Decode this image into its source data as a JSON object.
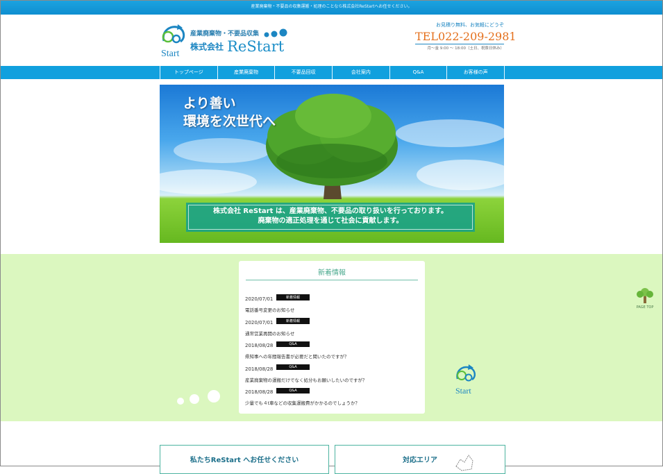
{
  "topbar": {
    "text": "産業廃棄物・不要品の収集運搬・処理のことなら株式会社ReStartへお任せください。"
  },
  "logo": {
    "subtitle": "産業廃棄物・不要品収集",
    "company_prefix": "株式会社",
    "company_name": "ReStart",
    "mark_text": "Start"
  },
  "contact": {
    "note": "お見積り無料、お気軽にどうぞ",
    "tel": "TEL022-209-2981",
    "hours": "月～金 9:00 ～ 18:00（土日、祝祭日休み）"
  },
  "nav": {
    "items": [
      "トップページ",
      "産業廃棄物",
      "不要品回収",
      "会社案内",
      "Q&A",
      "お客様の声"
    ]
  },
  "hero": {
    "title_line1": "より善い",
    "title_line2": "環境を次世代へ",
    "caption_line1": "株式会社 ReStart は、産業廃棄物、不要品の取り扱いを行っております。",
    "caption_line2": "廃棄物の適正処理を通じて社会に貢献します。"
  },
  "news": {
    "title": "新着情報",
    "items": [
      {
        "date": "2020/07/01",
        "tag": "新着情報",
        "text": "電話番号変更のお知らせ"
      },
      {
        "date": "2020/07/01",
        "tag": "新着情報",
        "text": "通常営業再開のお知らせ"
      },
      {
        "date": "2018/08/28",
        "tag": "Q&A",
        "text": "県知事への年間報告書が必要だと聞いたのですが？"
      },
      {
        "date": "2018/08/28",
        "tag": "Q&A",
        "text": "産業廃棄物の運搬だけでなく処分もお願いしたいのですが？"
      },
      {
        "date": "2018/08/28",
        "tag": "Q&A",
        "text": "少量でも４t車などの収集運搬費がかかるのでしょうか？"
      }
    ]
  },
  "badge": {
    "text": "Start"
  },
  "pagetop": {
    "label": "PAGE TOP"
  },
  "cards": {
    "left_title": "私たちReStart へお任せください",
    "right_title": "対応エリア"
  }
}
